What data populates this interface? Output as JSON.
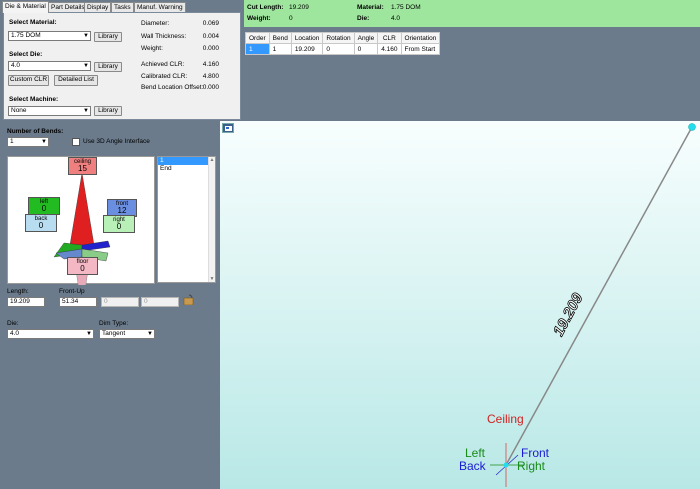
{
  "tabs": [
    "Die & Material",
    "Part Details",
    "Display",
    "Tasks",
    "Manuf. Warning"
  ],
  "material": {
    "select_material_label": "Select Material:",
    "material_value": "1.75 DOM",
    "library_label": "Library",
    "select_die_label": "Select Die:",
    "die_value": "4.0",
    "custom_clr_label": "Custom CLR",
    "detailed_list_label": "Detailed List",
    "select_machine_label": "Select Machine:",
    "machine_value": "None",
    "props": [
      {
        "label": "Diameter:",
        "value": "0.069"
      },
      {
        "label": "Wall Thickness:",
        "value": "0.004"
      },
      {
        "label": "Weight:",
        "value": "0.000"
      },
      {
        "label": "Achieved CLR:",
        "value": "4.160"
      },
      {
        "label": "Calibrated CLR:",
        "value": "4.800"
      },
      {
        "label": "Bend Location Offset:",
        "value": "0.000"
      }
    ]
  },
  "summary": {
    "cut_length_label": "Cut Length:",
    "cut_length": "19.209",
    "weight_label": "Weight:",
    "weight": "0",
    "material_label": "Material:",
    "material": "1.75 DOM",
    "die_label": "Die:",
    "die": "4.0"
  },
  "bend_table": {
    "headers": [
      "Order",
      "Bend",
      "Location",
      "Rotation",
      "Angle",
      "CLR",
      "Orientation"
    ],
    "rows": [
      [
        "1",
        "1",
        "19.209",
        "0",
        "0",
        "4.160",
        "From Start"
      ]
    ]
  },
  "bends": {
    "number_label": "Number of Bends:",
    "number_value": "1",
    "use_3d_label": "Use 3D Angle Interface",
    "list": [
      "1",
      "End"
    ],
    "directions": {
      "ceiling": {
        "label": "ceiling",
        "value": "15"
      },
      "left": {
        "label": "left",
        "value": "0"
      },
      "front": {
        "label": "front",
        "value": "12"
      },
      "back": {
        "label": "back",
        "value": "0"
      },
      "right": {
        "label": "right",
        "value": "0"
      },
      "floor": {
        "label": "floor",
        "value": "0"
      }
    },
    "length_label": "Length:",
    "length_value": "19.209",
    "frontup_label": "Front-Up",
    "frontup_value": "51.34",
    "extra1": "0",
    "extra2": "0",
    "die_label": "Die:",
    "die_value": "4.0",
    "dimtype_label": "Dim Type:",
    "dimtype_value": "Tangent"
  },
  "viewport": {
    "dimension_label": "19.209",
    "orientation": {
      "ceiling": "Ceiling",
      "left": "Left",
      "front": "Front",
      "back": "Back",
      "right": "Right"
    }
  },
  "colors": {
    "summary_bg": "#9ee69e",
    "viewport_bg": "#b8e8e6",
    "ceiling": "#d42020",
    "left_front": "#1a8a1a",
    "back_right": "#1a1ad4"
  }
}
